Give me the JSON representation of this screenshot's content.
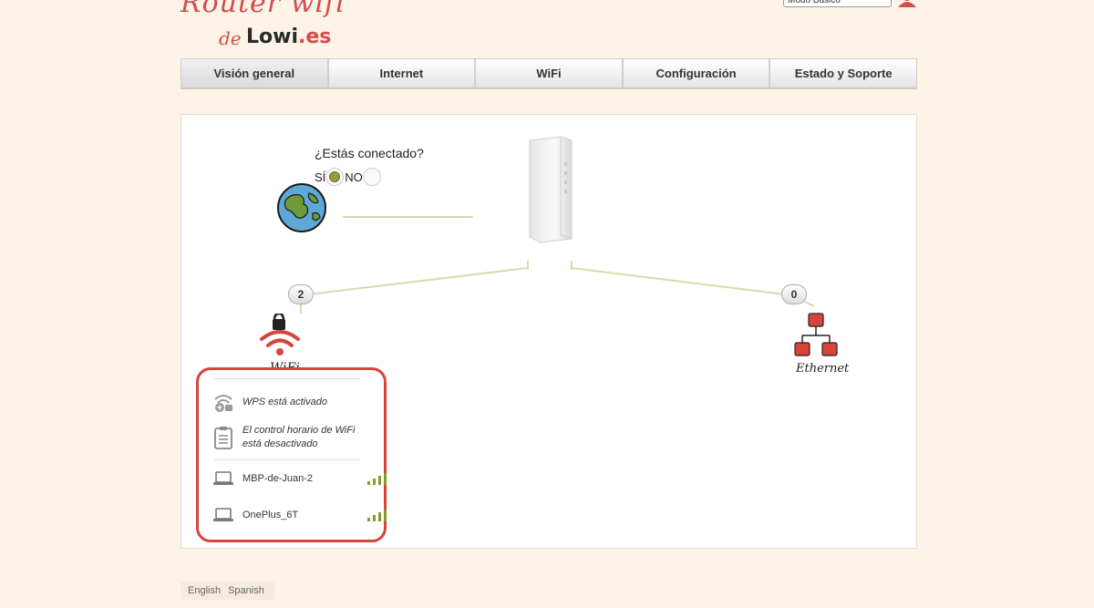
{
  "logo": {
    "script": "Router wifi",
    "de": "de",
    "brand": "Lowi",
    "tld": ".es"
  },
  "header": {
    "mode_select": "Modo Básico"
  },
  "tabs": [
    {
      "label": "Visión general",
      "active": true
    },
    {
      "label": "Internet"
    },
    {
      "label": "WiFi"
    },
    {
      "label": "Configuración"
    },
    {
      "label": "Estado y Soporte"
    }
  ],
  "overview": {
    "connected_question": "¿Estás conectado?",
    "yes_label": "SÍ",
    "no_label": "NO",
    "selected": "SÍ",
    "wifi_count": "2",
    "ethernet_count": "0",
    "wifi_label": "WiFi",
    "ethernet_label": "Ethernet"
  },
  "wifi_panel": {
    "wps_status": "WPS está activado",
    "schedule_status_line1": "El control horario de WiFi",
    "schedule_status_line2": "está desactivado",
    "devices": [
      {
        "name": "MBP-de-Juan-2",
        "signal_bars": 4
      },
      {
        "name": "OnePlus_6T",
        "signal_bars": 4
      }
    ]
  },
  "footer": {
    "languages": [
      "English",
      "Spanish"
    ]
  },
  "colors": {
    "accent_red": "#d6443a",
    "signal_green": "#8a9a2a",
    "line_green": "#d6dcae"
  }
}
